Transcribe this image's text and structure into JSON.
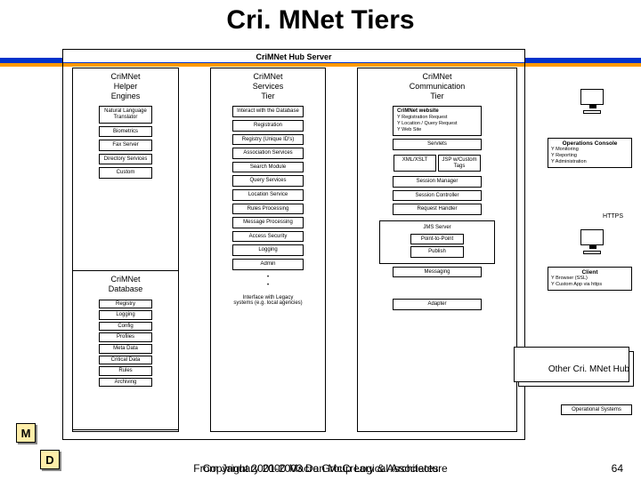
{
  "title": "Cri. MNet Tiers",
  "hub_label": "CriMNet Hub Server",
  "col1": {
    "title": "CriMNet\nHelper\nEngines",
    "items": [
      "Natural Language Translator",
      "Biometrics",
      "Fax Server",
      "Directory Services",
      "Custom"
    ]
  },
  "db": {
    "title": "CriMNet\nDatabase",
    "items": [
      "Registry",
      "Logging",
      "Config",
      "Profiles",
      "Meta Data",
      "Critical Data",
      "Rules",
      "Archiving"
    ]
  },
  "col2": {
    "title": "CriMNet\nServices\nTier",
    "items": [
      "Interact with the Database",
      "Registration",
      "Registry (Unique ID's)",
      "Association Services",
      "Search Module",
      "Query Services",
      "Location Service",
      "Rules Processing",
      "Message Processing",
      "Access Security",
      "Logging",
      "Admin",
      "•",
      "•",
      "Interface with Legacy systems (e.g. local agencies)"
    ]
  },
  "col3": {
    "title": "CriMNet\nCommunication\nTier",
    "website": {
      "title": "CriMNet website",
      "bullets": [
        "Y Registration Request",
        "Y Location / Query Request",
        "Y Web Site"
      ]
    },
    "row1a": "Servlets",
    "row1b": "XML/XSLT",
    "row1c": "JSP w/Custom Tags",
    "items2": [
      "Session Manager",
      "Session Controller",
      "Request Handler"
    ],
    "jms": "JMS Server",
    "p2p": "Point-to-Point",
    "pub": "Publish",
    "msg": "Messaging",
    "adapter": "Adapter"
  },
  "ops": {
    "title": "Operations Console",
    "bullets": [
      "Y Monitoring",
      "Y Reporting",
      "Y Administration"
    ]
  },
  "client": {
    "title": "Client",
    "bullets": [
      "Y Browser (SSL)",
      "Y Custom App via https"
    ]
  },
  "https_label": "HTTPS",
  "other_hub": "Other Cri. MNet Hub",
  "opsys": "Operational Systems",
  "badges": {
    "m": "M",
    "d": "D"
  },
  "footer_a": "Copyright 2001-2003 Dan McCreary & Associates",
  "footer_b": "From January 2000 Macro Group Logical Architecture",
  "footer_c": "64"
}
